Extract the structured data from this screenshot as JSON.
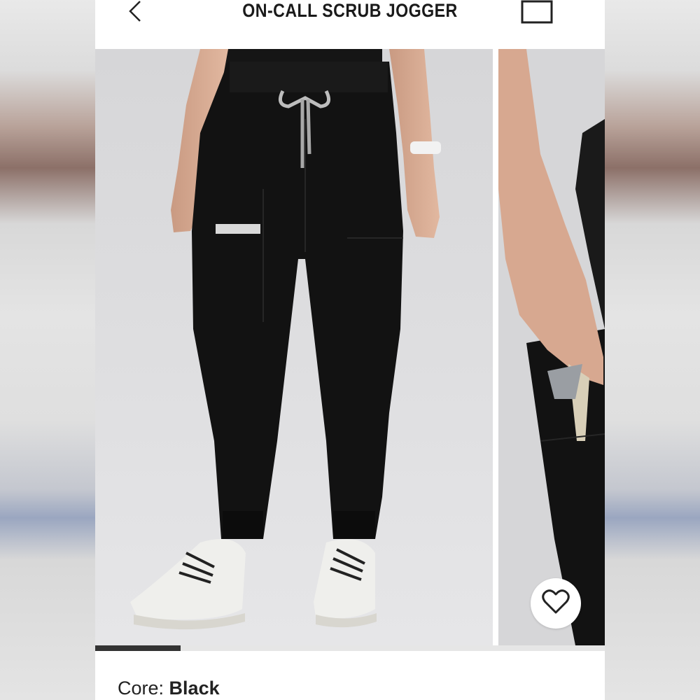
{
  "header": {
    "title": "ON-CALL SCRUB JOGGER",
    "back_icon": "chevron-left-icon",
    "bag_icon": "shopping-bag-icon"
  },
  "gallery": {
    "image_count": 2,
    "progress": 0.167,
    "slides": [
      {
        "subject": "black scrub jogger pants front view with white sneakers"
      },
      {
        "subject": "hand reaching into side pocket of black jogger"
      }
    ],
    "wishlist_icon": "heart-icon"
  },
  "product": {
    "color_label": "Core:",
    "color_value": "Black"
  },
  "colors": {
    "garment": "#111111",
    "background": "#d6d6d8",
    "progress_fill": "#333333",
    "progress_track": "#e6e6e6"
  }
}
